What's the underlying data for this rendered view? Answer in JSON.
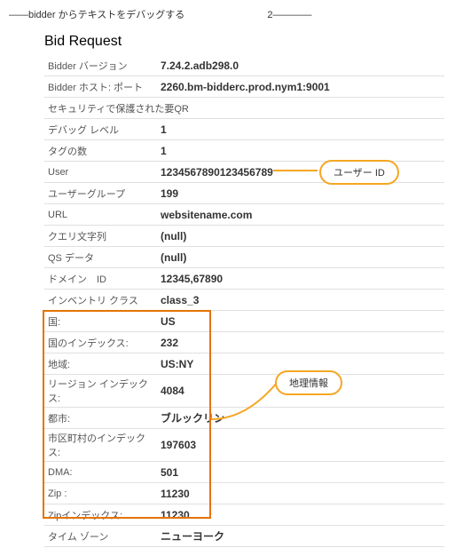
{
  "header": {
    "text": "――bidder からテキストをデバッグする",
    "num": "2――――"
  },
  "section_title": "Bid Request",
  "rows": [
    {
      "label": "Bidder バージョン",
      "value": "7.24.2.adb298.0"
    },
    {
      "label": "Bidder ホスト: ポート",
      "value": "2260.bm-bidderc.prod.nym1:9001"
    },
    {
      "label": "セキュリティで保護された要QR",
      "value": ""
    },
    {
      "label": "デバッグ レベル",
      "value": "1"
    },
    {
      "label": "タグの数",
      "value": "1"
    },
    {
      "label": "User ",
      "value": "1234567890123456789"
    },
    {
      "label": "ユーザーグループ",
      "value": "199"
    },
    {
      "label": "URL",
      "value": "websitename.com"
    },
    {
      "label": "クエリ文字列",
      "value": "(null)"
    },
    {
      "label": "QS データ",
      "value": "(null)"
    },
    {
      "label": "ドメイン　ID",
      "value": "12345,67890"
    },
    {
      "label": "インベントリ クラス",
      "value": "class_3"
    },
    {
      "label": "国:",
      "value": "US"
    },
    {
      "label": "国のインデックス:",
      "value": "232"
    },
    {
      "label": "地域:",
      "value": "US:NY"
    },
    {
      "label": "リージョン インデックス:",
      "value": "4084"
    },
    {
      "label": "都市:",
      "value": "ブルックリン"
    },
    {
      "label": "市区町村のインデックス:",
      "value": "197603"
    },
    {
      "label": "DMA:",
      "value": "501"
    },
    {
      "label": "Zip :",
      "value": "11230"
    },
    {
      "label": "Zipインデックス:",
      "value": "11230"
    },
    {
      "label": "タイム ゾーン",
      "value": "ニューヨーク"
    }
  ],
  "callouts": {
    "user": "ユーザー ID",
    "geo": "地理情報"
  }
}
